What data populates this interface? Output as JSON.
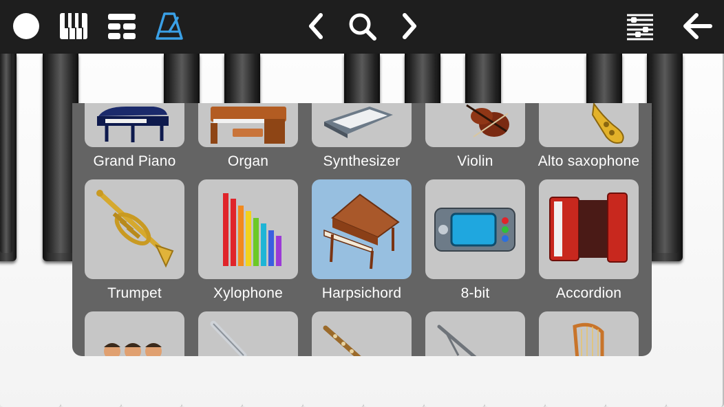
{
  "toolbar": {
    "left_icons": [
      "record-icon",
      "piano-keys-icon",
      "layout-icon",
      "metronome-icon"
    ],
    "center_icons": [
      "chevron-left-icon",
      "search-icon",
      "chevron-right-icon"
    ],
    "right_icons": [
      "mixer-sliders-icon",
      "back-arrow-icon"
    ],
    "accent_color": "#3aa0e6"
  },
  "instruments": {
    "row1": [
      {
        "label": "Grand Piano",
        "icon": "grand-piano-icon"
      },
      {
        "label": "Organ",
        "icon": "organ-icon"
      },
      {
        "label": "Synthesizer",
        "icon": "synthesizer-icon"
      },
      {
        "label": "Violin",
        "icon": "violin-icon"
      },
      {
        "label": "Alto saxophone",
        "icon": "saxophone-icon"
      }
    ],
    "row2": [
      {
        "label": "Trumpet",
        "icon": "trumpet-icon"
      },
      {
        "label": "Xylophone",
        "icon": "xylophone-icon"
      },
      {
        "label": "Harpsichord",
        "icon": "harpsichord-icon",
        "selected": true
      },
      {
        "label": "8-bit",
        "icon": "8bit-console-icon"
      },
      {
        "label": "Accordion",
        "icon": "accordion-icon"
      }
    ],
    "row3": [
      {
        "icon": "choir-icon"
      },
      {
        "icon": "flute-icon"
      },
      {
        "icon": "oboe-icon"
      },
      {
        "icon": "clarinet-icon"
      },
      {
        "icon": "harp-icon"
      }
    ]
  },
  "colors": {
    "tile": "#c6c6c6",
    "tile_selected": "#97bfe0",
    "overlay": "#646464",
    "toolbar": "#1e1e1e"
  }
}
